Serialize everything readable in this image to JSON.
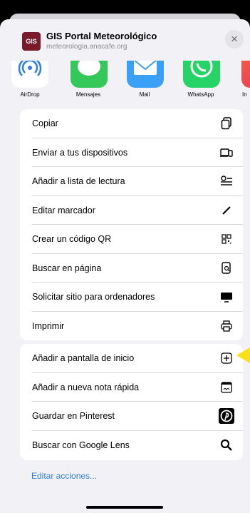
{
  "header": {
    "site_title": "GIS Portal Meteorológico",
    "site_domain": "meteorologia.anacafe.org",
    "favicon_text": "GIS",
    "close_icon": "×"
  },
  "apps": [
    {
      "name": "airdrop",
      "label": "AirDrop"
    },
    {
      "name": "mensajes",
      "label": "Mensajes"
    },
    {
      "name": "mail",
      "label": "Mail"
    },
    {
      "name": "whatsapp",
      "label": "WhatsApp"
    },
    {
      "name": "instagram",
      "label": "In"
    }
  ],
  "actions_group1": [
    {
      "label": "Copiar",
      "icon": "copy-icon"
    },
    {
      "label": "Enviar a tus dispositivos",
      "icon": "devices-icon"
    },
    {
      "label": "Añadir a lista de lectura",
      "icon": "reading-list-icon"
    },
    {
      "label": "Editar marcador",
      "icon": "pencil-icon"
    },
    {
      "label": "Crear un código QR",
      "icon": "qr-code-icon"
    },
    {
      "label": "Buscar en página",
      "icon": "find-in-page-icon"
    },
    {
      "label": "Solicitar sitio para ordenadores",
      "icon": "desktop-icon"
    },
    {
      "label": "Imprimir",
      "icon": "printer-icon"
    }
  ],
  "actions_group2": [
    {
      "label": "Añadir a pantalla de inicio",
      "icon": "add-square-icon"
    },
    {
      "label": "Añadir a nueva nota rápida",
      "icon": "quick-note-icon"
    },
    {
      "label": "Guardar en Pinterest",
      "icon": "pinterest-icon"
    },
    {
      "label": "Buscar con Google Lens",
      "icon": "search-icon"
    }
  ],
  "footer": {
    "edit_actions": "Editar acciones..."
  },
  "colors": {
    "accent_link": "#2f7de1",
    "highlight_arrow": "#f7e21a"
  }
}
